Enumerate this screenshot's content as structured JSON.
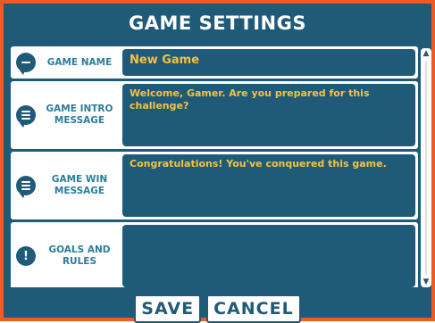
{
  "title": "GAME SETTINGS",
  "fields": {
    "name": {
      "label": "GAME NAME",
      "value": "New Game",
      "icon": "chat-bubble-icon"
    },
    "intro": {
      "label": "GAME INTRO MESSAGE",
      "value": "Welcome, Gamer. Are you prepared for this challenge?",
      "icon": "chat-bubble-icon"
    },
    "win": {
      "label": "GAME WIN MESSAGE",
      "value": "Congratulations! You've conquered this game.",
      "icon": "chat-bubble-icon"
    },
    "goals": {
      "label": "GOALS AND RULES",
      "value": "",
      "icon": "exclamation-icon"
    }
  },
  "scrollbar": {
    "up": "▲",
    "down": "▼"
  },
  "buttons": {
    "save": "SAVE",
    "cancel": "CANCEL"
  },
  "colors": {
    "frame": "#ee5a24",
    "panel": "#1f5b78",
    "accent_text": "#f6c23e",
    "label_text": "#2b7d9a"
  }
}
